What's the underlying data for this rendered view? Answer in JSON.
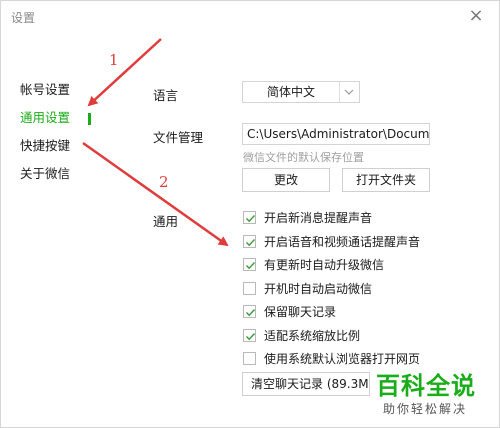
{
  "window": {
    "title": "设置",
    "close_glyph": "×"
  },
  "nav": {
    "items": [
      {
        "label": "帐号设置",
        "active": false
      },
      {
        "label": "通用设置",
        "active": true
      },
      {
        "label": "快捷按键",
        "active": false
      },
      {
        "label": "关于微信",
        "active": false
      }
    ]
  },
  "settings": {
    "language": {
      "label": "语言",
      "value": "简体中文"
    },
    "file_management": {
      "label": "文件管理",
      "path": "C:\\Users\\Administrator\\Docum",
      "hint": "微信文件的默认保存位置",
      "change_label": "更改",
      "open_folder_label": "打开文件夹"
    },
    "general": {
      "label": "通用",
      "options": [
        {
          "label": "开启新消息提醒声音",
          "checked": true
        },
        {
          "label": "开启语音和视频通话提醒声音",
          "checked": true
        },
        {
          "label": "有更新时自动升级微信",
          "checked": true
        },
        {
          "label": "开机时自动启动微信",
          "checked": false
        },
        {
          "label": "保留聊天记录",
          "checked": true
        },
        {
          "label": "适配系统缩放比例",
          "checked": true
        },
        {
          "label": "使用系统默认浏览器打开网页",
          "checked": false
        }
      ],
      "clear_history_label": "清空聊天记录 (89.3M"
    }
  },
  "annotations": {
    "arrow1_number": "1",
    "arrow2_number": "2",
    "color": "#e03c3c"
  },
  "watermark": {
    "title": "百科全说",
    "subtitle": "助你轻松解决"
  },
  "colors": {
    "accent": "#1aad19",
    "check": "#3a9b3a",
    "border": "#d4d4d4"
  }
}
